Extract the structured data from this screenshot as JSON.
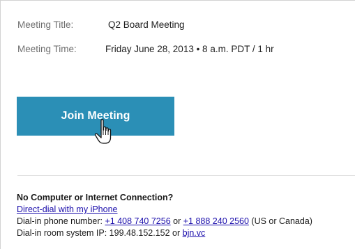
{
  "meeting": {
    "title_label": "Meeting Title:",
    "title_value": "Q2 Board Meeting",
    "time_label": "Meeting Time:",
    "time_value": "Friday June 28, 2013 • 8 a.m. PDT / 1 hr"
  },
  "join": {
    "label": "Join Meeting",
    "color": "#2b8fb6",
    "cursor_icon": "hand-pointer-icon"
  },
  "footer": {
    "heading": "No Computer or Internet Connection?",
    "iphone_link": "Direct-dial with my iPhone",
    "dialin_prefix": "Dial-in phone number: ",
    "phone1": "+1 408 740 7256",
    "or1": " or ",
    "phone2": "+1 888 240 2560",
    "dialin_suffix": " (US or Canada)",
    "room_prefix": "Dial-in room system IP: 199.48.152.152 or ",
    "room_link": "bjn.vc"
  },
  "colors": {
    "link": "#1a0dab",
    "label": "#6f6f6f"
  }
}
